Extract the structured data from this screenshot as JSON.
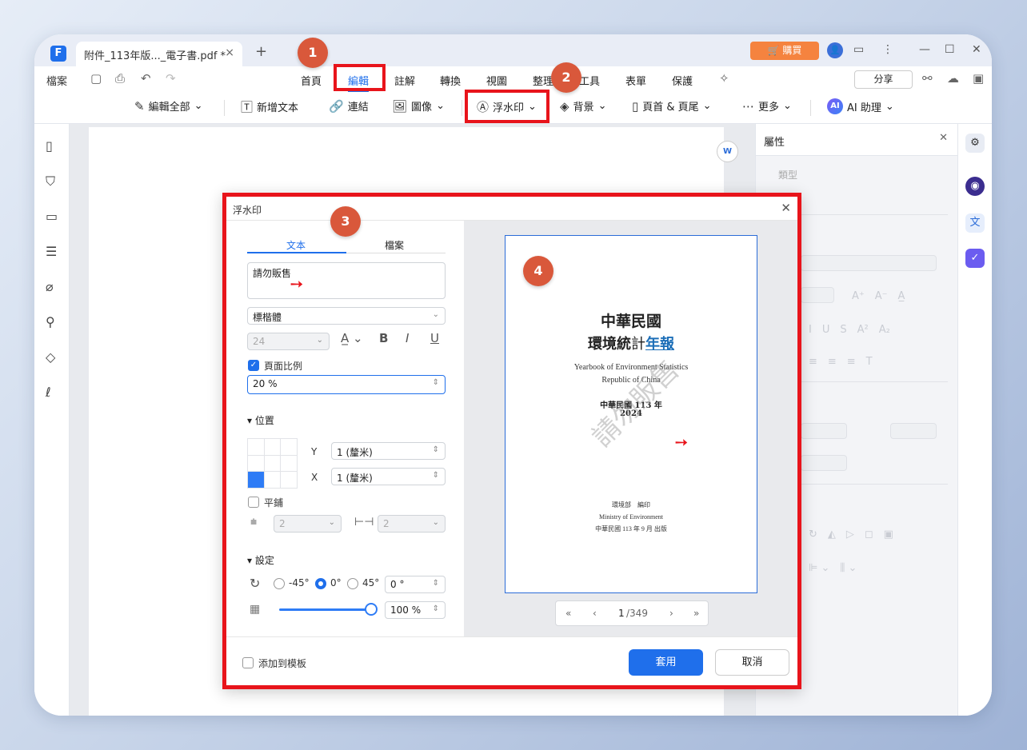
{
  "titlebar": {
    "tab_title": "附件_113年版..._電子書.pdf *",
    "close": "×",
    "add": "+",
    "buy_label": "🛒 購買",
    "window_controls": [
      "—",
      "☐",
      "✕"
    ]
  },
  "menubar": {
    "file": "檔案",
    "items": [
      "首頁",
      "編輯",
      "註解",
      "轉換",
      "視圖",
      "整理",
      "工具",
      "表單",
      "保護"
    ],
    "share": "分享"
  },
  "toolbar": {
    "edit_all": "編輯全部",
    "add_text": "新增文本",
    "link": "連結",
    "image": "圖像",
    "watermark": "浮水印",
    "background": "背景",
    "header_footer": "頁首 & 頁尾",
    "more": "更多",
    "ai_assistant": "AI 助理",
    "ai_icon_text": "AI"
  },
  "properties": {
    "title": "屬性",
    "type_label": "類型"
  },
  "dialog": {
    "title": "浮水印",
    "tab_text": "文本",
    "tab_file": "檔案",
    "watermark_text": "請勿販售",
    "font": "標楷體",
    "font_size": "24",
    "page_ratio_label": "頁面比例",
    "page_ratio_value": "20 %",
    "position_label": "位置",
    "y_label": "Y",
    "y_value": "1 (釐米)",
    "x_label": "X",
    "x_value": "1 (釐米)",
    "tile_label": "平鋪",
    "spacing_v": "2",
    "spacing_h": "2",
    "settings_label": "設定",
    "rot_neg45": "-45°",
    "rot_0": "0°",
    "rot_45": "45°",
    "rotation_value": "0 °",
    "opacity_value": "100 %",
    "add_to_template": "添加到模板",
    "apply": "套用",
    "cancel": "取消"
  },
  "preview": {
    "title_line1": "中華民國",
    "title_line2a": "環境統",
    "title_line2b": "計",
    "title_line2c": "年報",
    "en_line1": "Yearbook of Environment Statistics",
    "en_line2": "Republic of China",
    "year_line": "中華民國 113 年",
    "year_num": "2024",
    "watermark": "請勿販售",
    "publisher": "環境部　編印",
    "publisher_en": "Ministry of Environment",
    "publish_date": "中華民國 113 年 9 月 出版",
    "page_current": "1",
    "page_total": "/349"
  },
  "badges": [
    "1",
    "2",
    "3",
    "4"
  ],
  "colors": {
    "accent": "#1f6feb",
    "highlight": "#e8141b",
    "badge": "#d9583b",
    "buy": "#f5833f"
  }
}
